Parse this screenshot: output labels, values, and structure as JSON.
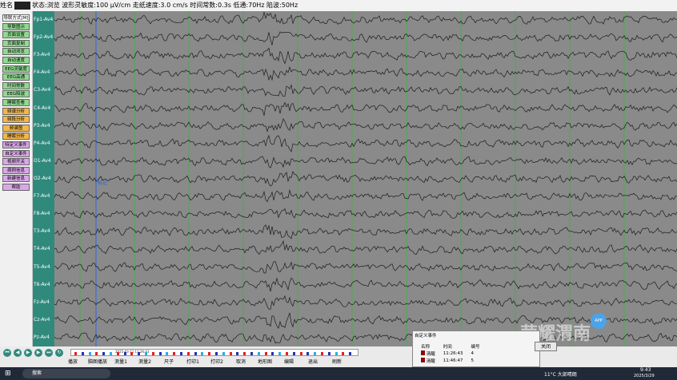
{
  "topbar": {
    "prefix": "姓名",
    "status": "状态:浏览 波形灵敏度:100 μV/cm 走纸速度:3.0 cm/s 时间常数:0.3s 低通:70Hz 陷波:50Hz"
  },
  "sidebar": {
    "items": [
      {
        "label": "导联方式[M]",
        "color": "#ffffff"
      },
      {
        "label": "导联图示",
        "color": "#8fd98f"
      },
      {
        "label": "页面设置",
        "color": "#8fd98f"
      },
      {
        "label": "页面复制",
        "color": "#8fd98f"
      },
      {
        "label": "自动浏览",
        "color": "#8fd98f"
      },
      {
        "label": "自动速度",
        "color": "#8fd98f"
      },
      {
        "label": "EEG灵敏度",
        "color": "#8fd98f"
      },
      {
        "label": "EEG高通",
        "color": "#8fd98f"
      },
      {
        "label": "时间常数",
        "color": "#8fd98f"
      },
      {
        "label": "EEG陷波",
        "color": "#8fd98f"
      },
      {
        "label": "睡眠查看",
        "color": "#8fd98f"
      },
      {
        "label": "频谱分析",
        "color": "#f2b64a"
      },
      {
        "label": "频段分析",
        "color": "#f2b64a"
      },
      {
        "label": "频谱图",
        "color": "#f2b64a"
      },
      {
        "label": "睡眠分析",
        "color": "#f2b64a"
      },
      {
        "label": "特定义事件",
        "color": "#d9a8e8"
      },
      {
        "label": "自定义事件",
        "color": "#d9a8e8"
      },
      {
        "label": "视频开关",
        "color": "#d9a8e8"
      },
      {
        "label": "病例信息",
        "color": "#d9a8e8"
      },
      {
        "label": "新建信息",
        "color": "#d9a8e8"
      },
      {
        "label": "帮助",
        "color": "#d9a8e8"
      }
    ]
  },
  "channels": [
    "Fp1-Av4",
    "Fp2-Av4",
    "F3-Av4",
    "F4-Av4",
    "C3-Av4",
    "C4-Av4",
    "P3-Av4",
    "P4-Av4",
    "O1-Av4",
    "O2-Av4",
    "F7-Av4",
    "F8-Av4",
    "T3-Av4",
    "T4-Av4",
    "T5-Av4",
    "T6-Av4",
    "Fz-Av4",
    "Cz-Av4",
    "Pz-Av4"
  ],
  "marker": "标记",
  "toolbar": {
    "nav_icons": [
      "first-icon",
      "prev-icon",
      "play-icon",
      "next-icon",
      "last-icon",
      "refresh-icon"
    ],
    "timestamp": "2025-03-11 11:26:43",
    "buttons": [
      "播放",
      "脑图播放",
      "测量1",
      "测量2",
      "尺子",
      "打印1",
      "打印2",
      "取消",
      "地形图",
      "编辑",
      "退出",
      "刷新"
    ]
  },
  "event_dialog": {
    "title": "自定义事件",
    "headers": [
      "名称",
      "时间",
      "编号"
    ],
    "rows": [
      {
        "name": "清醒",
        "time": "11:26:43",
        "num": "4"
      },
      {
        "name": "清醒",
        "time": "11:46:47",
        "num": "5"
      }
    ],
    "close": "关闭"
  },
  "watermark": "荣耀渭南",
  "app_icon_text": "APP",
  "taskbar": {
    "search": "搜索",
    "weather": "11°C 大部晴朗",
    "time": "9:43",
    "date": "2025/3/29"
  }
}
